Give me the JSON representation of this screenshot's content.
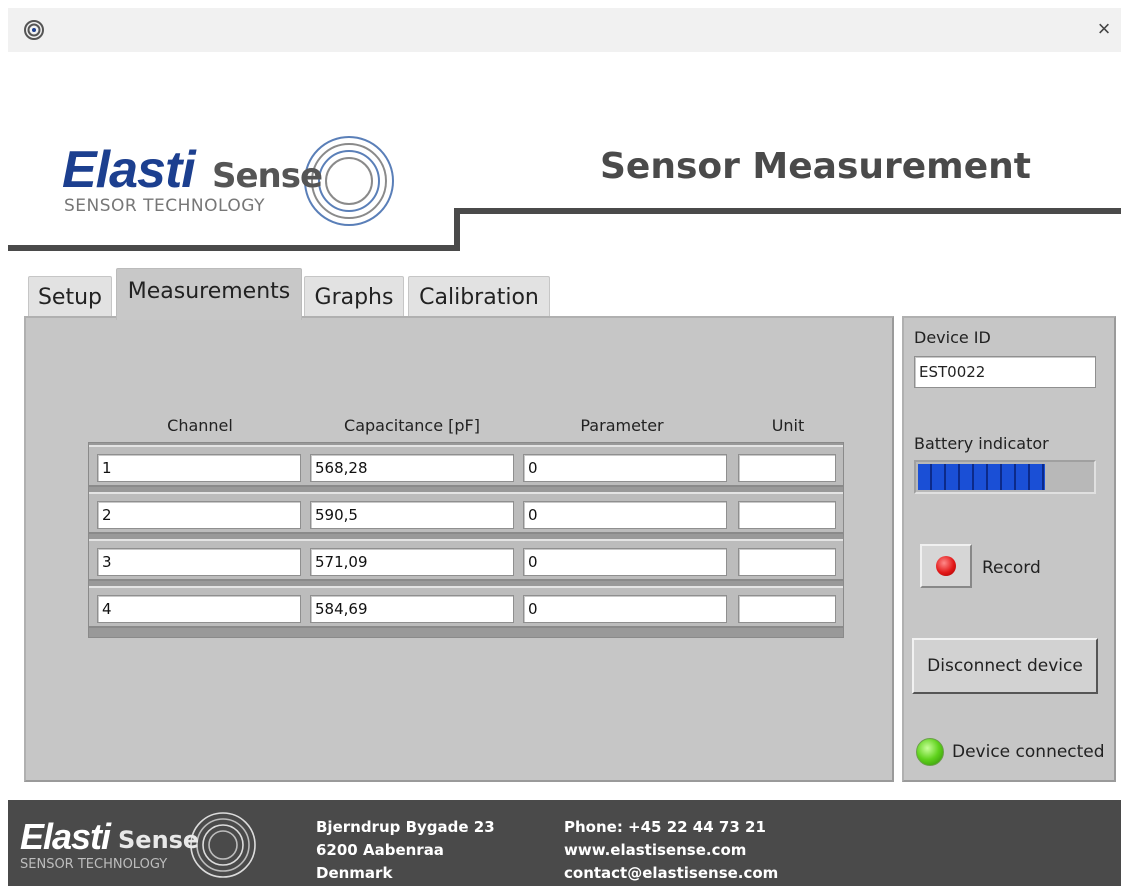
{
  "window": {
    "app_icon": "target-icon",
    "close_glyph": "×"
  },
  "header": {
    "logo_elasti": "Elasti",
    "logo_sense": "Sense",
    "logo_tagline": "SENSOR TECHNOLOGY",
    "title": "Sensor Measurement"
  },
  "tabs": [
    {
      "label": "Setup",
      "active": false
    },
    {
      "label": "Measurements",
      "active": true
    },
    {
      "label": "Graphs",
      "active": false
    },
    {
      "label": "Calibration",
      "active": false
    }
  ],
  "table": {
    "columns": [
      "Channel",
      "Capacitance [pF]",
      "Parameter",
      "Unit"
    ],
    "rows": [
      {
        "channel": "1",
        "capacitance": "568,28",
        "parameter": "0",
        "unit": ""
      },
      {
        "channel": "2",
        "capacitance": "590,5",
        "parameter": "0",
        "unit": ""
      },
      {
        "channel": "3",
        "capacitance": "571,09",
        "parameter": "0",
        "unit": ""
      },
      {
        "channel": "4",
        "capacitance": "584,69",
        "parameter": "0",
        "unit": ""
      }
    ]
  },
  "side": {
    "device_id_label": "Device ID",
    "device_id_value": "EST0022",
    "battery_label": "Battery indicator",
    "battery_level": 0.73,
    "record_label": "Record",
    "disconnect_label": "Disconnect device",
    "status_label": "Device connected",
    "status_color": "#5fd21c"
  },
  "footer": {
    "logo_elasti": "Elasti",
    "logo_sense": "Sense",
    "logo_tagline": "SENSOR TECHNOLOGY",
    "address_line1": "Bjerndrup Bygade 23",
    "address_line2": "6200 Aabenraa",
    "address_line3": "Denmark",
    "phone": "Phone: +45 22 44 73 21",
    "web": "www.elastisense.com",
    "email": "contact@elastisense.com"
  },
  "colors": {
    "brand_blue": "#1c3f8f",
    "panel_gray": "#c6c6c6",
    "footer_bg": "#4a4a4a",
    "battery_blue": "#1a4fd6",
    "record_red": "#e21818"
  }
}
